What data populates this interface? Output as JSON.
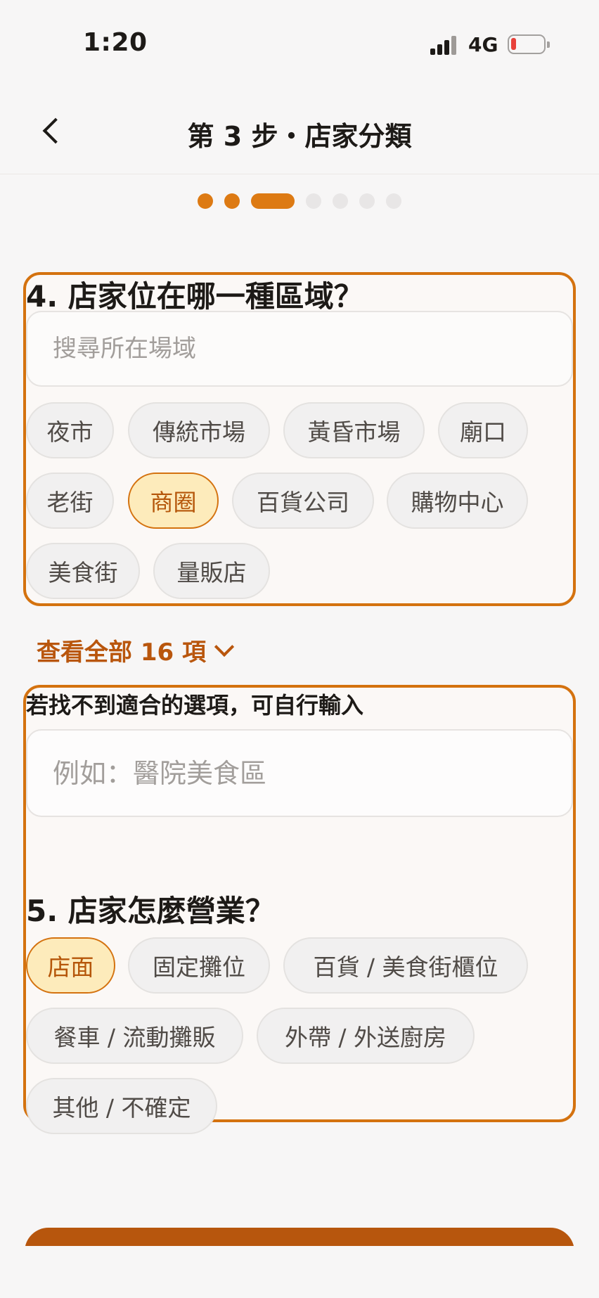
{
  "status_bar": {
    "time": "1:20",
    "network": "4G"
  },
  "header": {
    "title": "第 3 步・店家分類"
  },
  "progress": {
    "total_steps": 7,
    "current_step": 3
  },
  "question4": {
    "title": "4. 店家位在哪一種區域？",
    "search_placeholder": "搜尋所在場域",
    "chips": [
      "夜市",
      "傳統市場",
      "黃昏市場",
      "廟口",
      "老街",
      "商圈",
      "百貨公司",
      "購物中心",
      "美食街",
      "量販店"
    ],
    "selected": "商圈",
    "view_all_label": "查看全部 16 項"
  },
  "custom": {
    "label": "若找不到適合的選項，可自行輸入",
    "placeholder": "例如：醫院美食區"
  },
  "question5": {
    "title": "5. 店家怎麼營業？",
    "chips": [
      "店面",
      "固定攤位",
      "百貨 / 美食街櫃位",
      "餐車 / 流動攤販",
      "外帶 / 外送廚房",
      "其他 / 不確定"
    ],
    "selected": "店面"
  },
  "colors": {
    "accent": "#dd7a13",
    "accent_dark": "#b7560d",
    "chip_selected_bg": "#fdebbb",
    "battery_low": "#e8413a"
  }
}
